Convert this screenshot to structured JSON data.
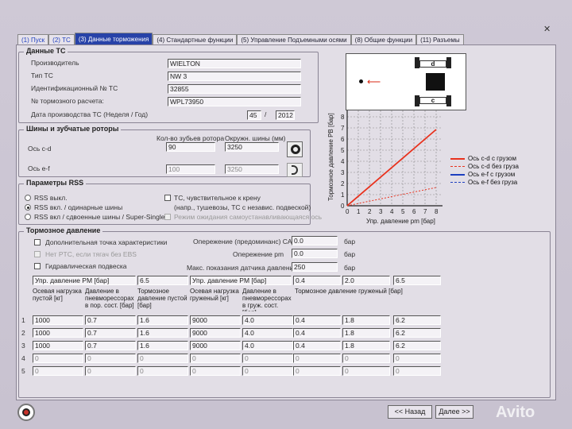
{
  "tabs": [
    {
      "label": "(1) Пуск"
    },
    {
      "label": "(2) ТС"
    },
    {
      "label": "(3) Данные торможения"
    },
    {
      "label": "(4) Стандартные функции"
    },
    {
      "label": "(5) Управление Подъемными осями"
    },
    {
      "label": "(8) Общие функции"
    },
    {
      "label": "(11) Разъемы"
    }
  ],
  "vehicle": {
    "title": "Данные ТС",
    "manufacturer_label": "Производитель",
    "manufacturer": "WIELTON",
    "type_label": "Тип ТС",
    "type": "NW 3",
    "id_label": "Идентификационный № ТС",
    "id": "32855",
    "calc_label": "№ тормозного расчета:",
    "calc": "WPL73950",
    "date_label": "Дата производства ТС (Неделя / Год)",
    "week": "45",
    "year": "2012"
  },
  "tires": {
    "title": "Шины и зубчатые роторы",
    "teeth_header": "Кол-во зубьев ротора",
    "circ_header": "Окружн. шины (мм)",
    "axle_cd_label": "Ось c-d",
    "cd_teeth": "90",
    "cd_circ": "3250",
    "axle_ef_label": "Ось e-f",
    "ef_teeth": "100",
    "ef_circ": "3250"
  },
  "rss": {
    "title": "Параметры RSS",
    "opt_off": "RSS выкл.",
    "opt_single": "RSS вкл. / одинарные шины",
    "opt_twin": "RSS вкл / сдвоенные шины / Super-Single",
    "roll_sensitive": "ТС, чувствительное к крену",
    "roll_sub": "(напр., тушевозы, ТС с независ. подвеской)",
    "self_wait": "Режим ожидания самоустанавливающаяся ось"
  },
  "brake": {
    "title": "Тормозное давление",
    "extra_point": "Дополнительная точка характеристики",
    "no_ptc": "Нет PTC, если тягач без EBS",
    "hydraulic": "Гидравлическая подвеска",
    "advance_can_label": "Опережение (предоминанс) CAN",
    "advance_can": "0.0",
    "advance_pm_label": "Опережение pm",
    "advance_pm": "0.0",
    "max_sensor_label": "Макс. показания датчика давления",
    "max_sensor": "250",
    "unit_bar": "бар"
  },
  "table": {
    "pm_header_left": "Упр. давление PM [бар]",
    "pm_left_value": "6.5",
    "pm_header_right": "Упр. давление PM [бар]",
    "pm_right_values": [
      "0.4",
      "2.0",
      "6.5"
    ],
    "col_empty_load": "Осевая нагрузка пустой [кг]",
    "col_press_empty": "Давление в пневморессорах в пор. сост. [бар]",
    "col_brake_empty": "Тормозное давление пустой [бар]",
    "col_load_loaded": "Осевая нагрузка груженый [кг]",
    "col_press_loaded": "Давление в пневморессорах в груж. сост. [бар]",
    "col_brake_loaded": "Тормозное давление груженый [бар]",
    "rows": [
      {
        "n": "1",
        "empty_load": "1000",
        "press_empty": "0.7",
        "brake_empty": "1.6",
        "load": "9000",
        "press_loaded": "4.0",
        "b1": "0.4",
        "b2": "1.8",
        "b3": "6.2"
      },
      {
        "n": "2",
        "empty_load": "1000",
        "press_empty": "0.7",
        "brake_empty": "1.6",
        "load": "9000",
        "press_loaded": "4.0",
        "b1": "0.4",
        "b2": "1.8",
        "b3": "6.2"
      },
      {
        "n": "3",
        "empty_load": "1000",
        "press_empty": "0.7",
        "brake_empty": "1.6",
        "load": "9000",
        "press_loaded": "4.0",
        "b1": "0.4",
        "b2": "1.8",
        "b3": "6.2"
      },
      {
        "n": "4",
        "empty_load": "0",
        "press_empty": "0",
        "brake_empty": "0",
        "load": "0",
        "press_loaded": "0",
        "b1": "0",
        "b2": "0",
        "b3": "0"
      },
      {
        "n": "5",
        "empty_load": "0",
        "press_empty": "0",
        "brake_empty": "0",
        "load": "0",
        "press_loaded": "0",
        "b1": "0",
        "b2": "0",
        "b3": "0"
      }
    ]
  },
  "diagram": {
    "label_d": "d",
    "label_c": "c"
  },
  "chart": {
    "ylabel": "Тормозное давление PB [бар]",
    "xlabel": "Упр. давление pm [бар]",
    "ticks": [
      "0",
      "1",
      "2",
      "3",
      "4",
      "5",
      "6",
      "7",
      "8"
    ],
    "legend": [
      {
        "name": "Ось c-d с грузом",
        "color": "#e8321e"
      },
      {
        "name": "Ось c-d без груза",
        "color": "#e8321e"
      },
      {
        "name": "Ось e-f с грузом",
        "color": "#1d3fbf"
      },
      {
        "name": "Ось e-f без груза",
        "color": "#1d3fbf"
      }
    ]
  },
  "footer": {
    "back": "<< Назад",
    "next": "Далее >>",
    "avito": "Avito"
  },
  "colors": {
    "accent": "#2742a8",
    "loaded": "#e8321e",
    "empty_line": "#e8321e"
  }
}
